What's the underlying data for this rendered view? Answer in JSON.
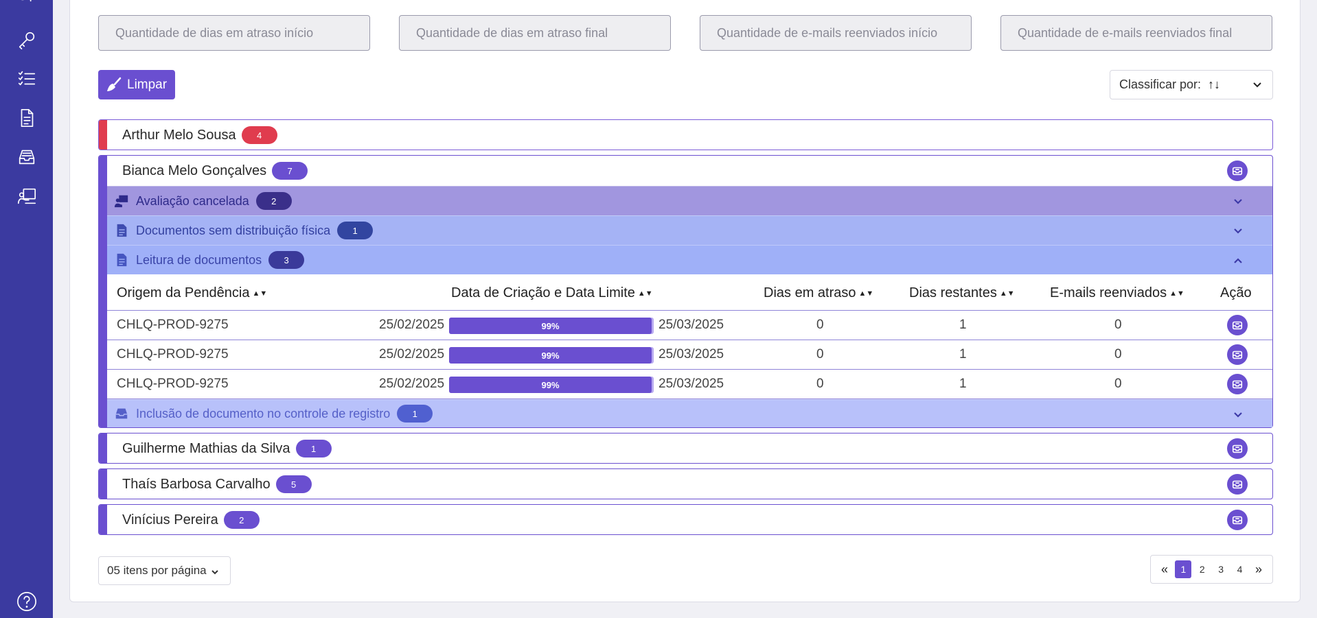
{
  "filters": {
    "dias_atraso_inicio": "Quantidade de dias em atraso início",
    "dias_atraso_final": "Quantidade de dias em atraso final",
    "emails_inicio": "Quantidade de e-mails reenviados início",
    "emails_final": "Quantidade de e-mails reenviados final"
  },
  "toolbar": {
    "clear_label": "Limpar",
    "sort_label": "Classificar por:",
    "sort_icon": "↑↓",
    "sort_icon_name": "sort-numeric-icon"
  },
  "colors": {
    "primary": "#6a4fd0",
    "sidebar": "#3b3aa0",
    "danger": "#e03c4e"
  },
  "people": [
    {
      "name": "Arthur Melo Sousa",
      "count": "4"
    },
    {
      "name": "Bianca Melo Gonçalves",
      "count": "7"
    },
    {
      "name": "Guilherme Mathias da Silva",
      "count": "1"
    },
    {
      "name": "Thaís Barbosa Carvalho",
      "count": "5"
    },
    {
      "name": "Vinícius Pereira",
      "count": "2"
    }
  ],
  "categories": [
    {
      "label": "Avaliação cancelada",
      "count": "2"
    },
    {
      "label": "Documentos sem distribuição física",
      "count": "1"
    },
    {
      "label": "Leitura de documentos",
      "count": "3"
    },
    {
      "label": "Inclusão de documento no controle de registro",
      "count": "1"
    }
  ],
  "table": {
    "headers": {
      "origem": "Origem da Pendência",
      "datas": "Data de Criação e Data Limite",
      "atraso": "Dias em atraso",
      "restantes": "Dias restantes",
      "emails": "E-mails reenviados",
      "acao": "Ação"
    },
    "sort_glyph": "▲▼",
    "rows": [
      {
        "origem": "CHLQ-PROD-9275",
        "criacao": "25/02/2025",
        "progress": "99%",
        "progress_value": 99,
        "limite": "25/03/2025",
        "atraso": "0",
        "restantes": "1",
        "emails": "0"
      },
      {
        "origem": "CHLQ-PROD-9275",
        "criacao": "25/02/2025",
        "progress": "99%",
        "progress_value": 99,
        "limite": "25/03/2025",
        "atraso": "0",
        "restantes": "1",
        "emails": "0"
      },
      {
        "origem": "CHLQ-PROD-9275",
        "criacao": "25/02/2025",
        "progress": "99%",
        "progress_value": 99,
        "limite": "25/03/2025",
        "atraso": "0",
        "restantes": "1",
        "emails": "0"
      }
    ]
  },
  "pagination": {
    "per_page": "05 itens por página",
    "first": "«",
    "last": "»",
    "pages": [
      "1",
      "2",
      "3",
      "4"
    ],
    "current": "1"
  }
}
